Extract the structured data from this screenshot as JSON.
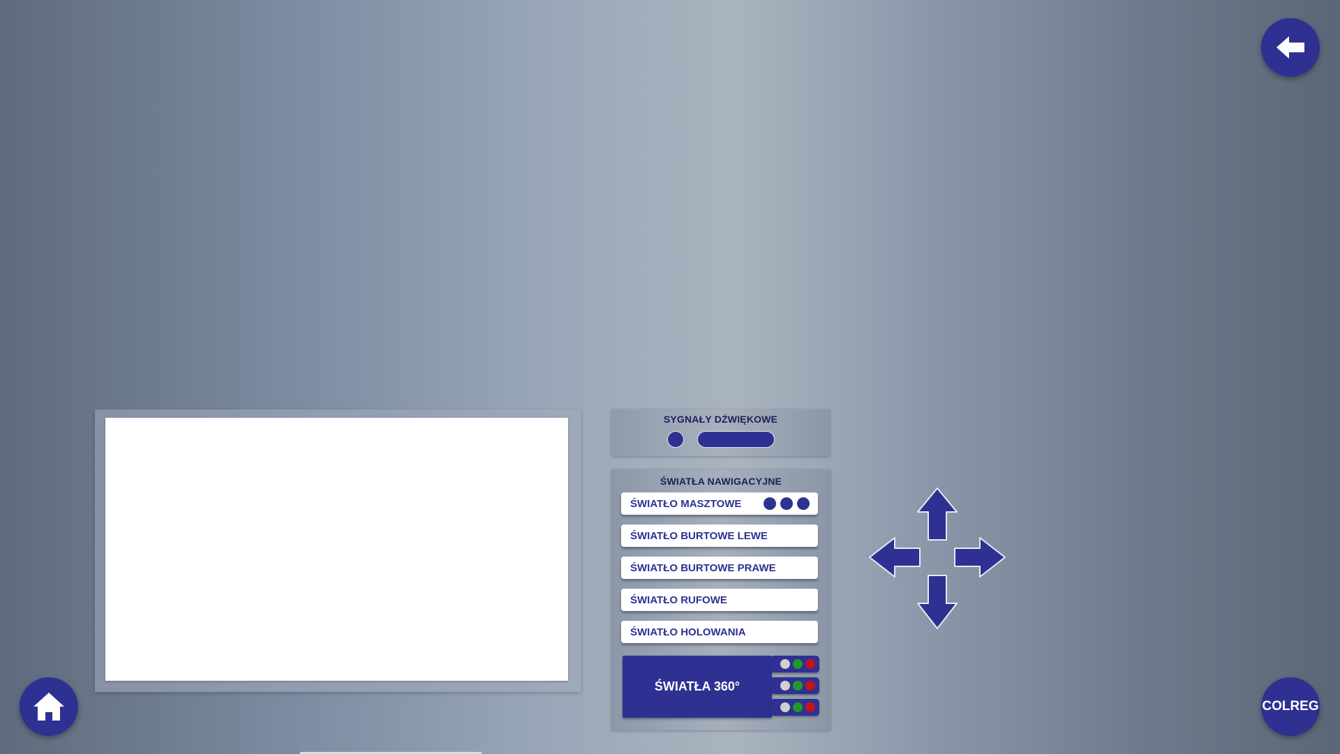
{
  "sound_signals": {
    "title": "SYGNAŁY DŹWIĘKOWE"
  },
  "navigation_lights": {
    "title": "ŚWIATŁA NAWIGACYJNE",
    "buttons": [
      {
        "label": "ŚWIATŁO MASZTOWE",
        "dots": 3
      },
      {
        "label": "ŚWIATŁO BURTOWE LEWE"
      },
      {
        "label": "ŚWIATŁO BURTOWE PRAWE"
      },
      {
        "label": "ŚWIATŁO RUFOWE"
      },
      {
        "label": "ŚWIATŁO HOLOWANIA"
      }
    ],
    "lights_360": {
      "label": "ŚWIATŁA 360°",
      "toggles": 3,
      "colors": [
        "#d0d0d0",
        "#1f9a2a",
        "#c0141e"
      ]
    }
  },
  "corner_buttons": {
    "colreg_label": "COLREG"
  },
  "icons": {
    "back": "back-arrow-icon",
    "home": "home-icon",
    "move": [
      "arrow-up-icon",
      "arrow-down-icon",
      "arrow-left-icon",
      "arrow-right-icon"
    ]
  },
  "colors": {
    "accent": "#2e3192",
    "panel_text": "#1d1f5a"
  }
}
